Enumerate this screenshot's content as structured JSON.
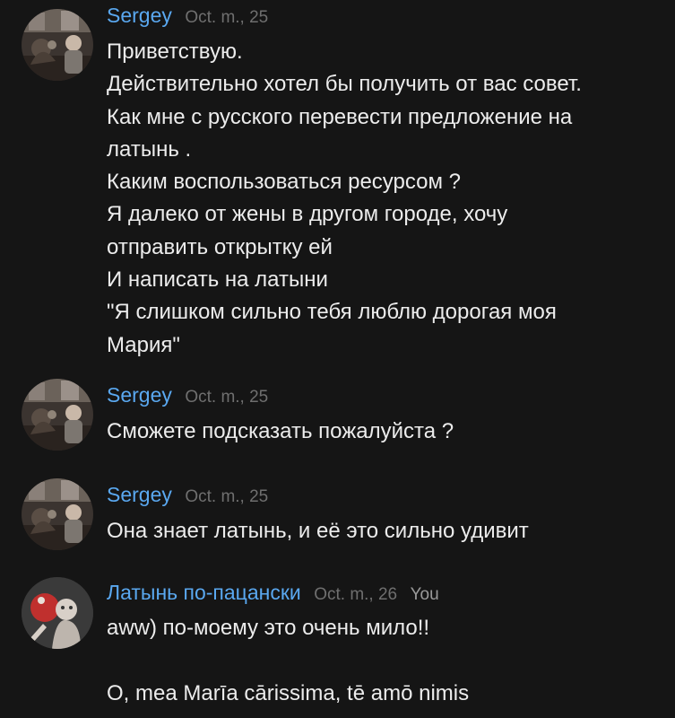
{
  "messages": [
    {
      "author": "Sergey",
      "date": "Oct. m., 25",
      "avatar": "sergey-avatar",
      "lines": [
        "Приветствую.",
        "Действительно хотел бы получить от вас совет.",
        "Как мне с русского перевести предложение на",
        "латынь .",
        "Каким воспользоваться ресурсом ?",
        "Я далеко от жены в другом городе, хочу",
        "отправить открытку ей",
        "И написать на латыни",
        "\"Я слишком сильно тебя люблю дорогая моя",
        "Мария\""
      ]
    },
    {
      "author": "Sergey",
      "date": "Oct. m., 25",
      "avatar": "sergey-avatar",
      "lines": [
        "Сможете подсказать пожалуйста ?"
      ]
    },
    {
      "author": "Sergey",
      "date": "Oct. m., 25",
      "avatar": "sergey-avatar",
      "lines": [
        "Она знает латынь, и её это сильно удивит"
      ]
    },
    {
      "author": "Латынь по-пацански",
      "date": "Oct. m., 26",
      "tag": "You",
      "avatar": "channel-avatar",
      "lines": [
        "aww) по-моему это очень мило!!",
        "",
        "O, mea Marīa cārissima, tē amō nimis"
      ]
    }
  ],
  "colors": {
    "background": "#151515",
    "author_name": "#5aa8f0",
    "date": "#6f6f6f",
    "text": "#ececec"
  }
}
